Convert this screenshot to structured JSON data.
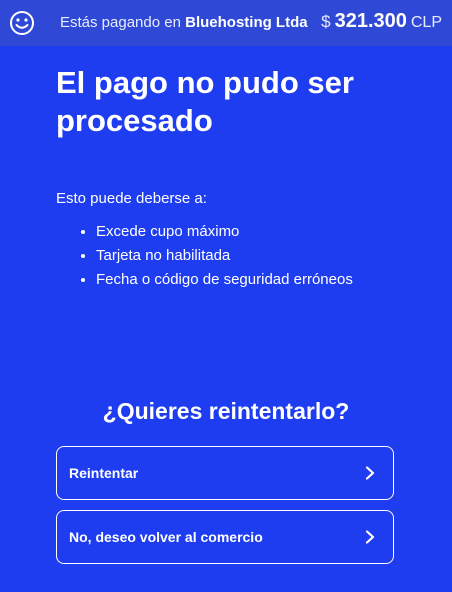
{
  "header": {
    "logo_icon": "smiley-icon",
    "paying_prefix": "Estás pagando en",
    "merchant": "Bluehosting Ltda",
    "currency_symbol": "$",
    "amount": "321.300",
    "currency_code": "CLP"
  },
  "main": {
    "title": "El pago no pudo ser procesado",
    "intro": "Esto puede deberse a:",
    "reasons": [
      "Excede cupo máximo",
      "Tarjeta no habilitada",
      "Fecha o código de seguridad erróneos"
    ],
    "question": "¿Quieres reintentarlo?",
    "buttons": [
      {
        "label": "Reintentar",
        "icon": "chevron-right-icon"
      },
      {
        "label": "No, deseo volver al comercio",
        "icon": "chevron-right-icon"
      }
    ]
  },
  "colors": {
    "background": "#1f3df0",
    "header_bg": "#2f49d6",
    "text": "#ffffff"
  }
}
